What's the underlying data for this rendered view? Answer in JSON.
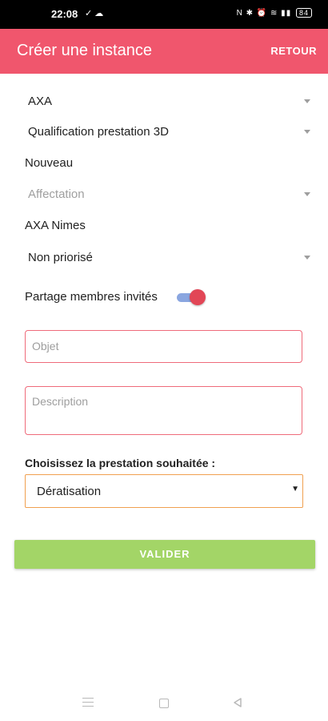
{
  "status_bar": {
    "time": "22:08",
    "left_icons": "✓ ☁",
    "right_icons": "N ✱ ⏰ ≋ ▮▮",
    "battery": "84"
  },
  "app_bar": {
    "title": "Créer une instance",
    "back_label": "RETOUR"
  },
  "form": {
    "company": "AXA",
    "service_type": "Qualification prestation 3D",
    "status": "Nouveau",
    "assignment_placeholder": "Affectation",
    "agency": "AXA Nimes",
    "priority": "Non priorisé",
    "share_label": "Partage membres invités",
    "share_enabled": true,
    "object_placeholder": "Objet",
    "description_placeholder": "Description",
    "service_question": "Choisissez la prestation souhaitée :",
    "service_selected": "Dératisation",
    "submit_label": "VALIDER"
  },
  "colors": {
    "accent": "#f0566d",
    "submit": "#a3d567",
    "field_border": "#ef6b7b",
    "select_border": "#f0a050",
    "switch_knob": "#e24656"
  }
}
